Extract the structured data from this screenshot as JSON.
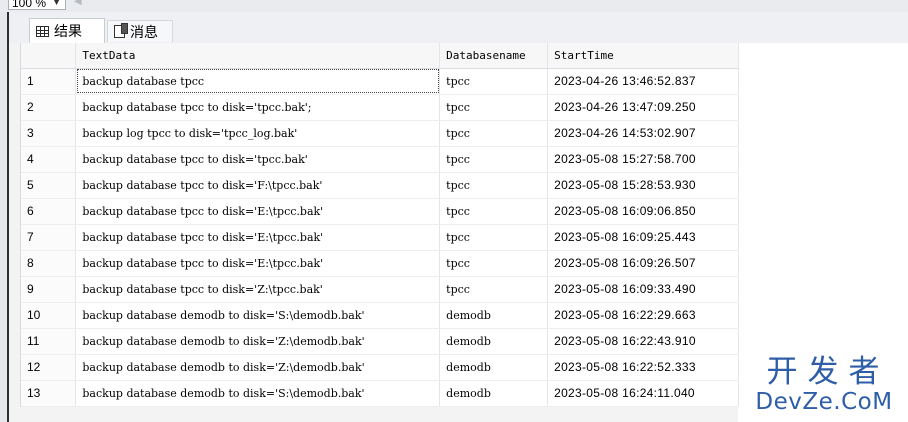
{
  "zoom": {
    "value": "100 %"
  },
  "tabs": [
    {
      "label": "结果",
      "icon": "grid-icon",
      "active": true
    },
    {
      "label": "消息",
      "icon": "message-icon",
      "active": false
    }
  ],
  "grid": {
    "columns": [
      "TextData",
      "Databasename",
      "StartTime"
    ],
    "rows": [
      {
        "num": "1",
        "text": "backup database tpcc",
        "db": "tpcc",
        "time": "2023-04-26 13:46:52.837"
      },
      {
        "num": "2",
        "text": "backup database tpcc to disk='tpcc.bak';",
        "db": "tpcc",
        "time": "2023-04-26 13:47:09.250"
      },
      {
        "num": "3",
        "text": "backup log tpcc to disk='tpcc_log.bak'",
        "db": "tpcc",
        "time": "2023-04-26 14:53:02.907"
      },
      {
        "num": "4",
        "text": "backup database tpcc to disk='tpcc.bak'",
        "db": "tpcc",
        "time": "2023-05-08 15:27:58.700"
      },
      {
        "num": "5",
        "text": "backup database tpcc to disk='F:\\tpcc.bak'",
        "db": "tpcc",
        "time": "2023-05-08 15:28:53.930"
      },
      {
        "num": "6",
        "text": "backup database tpcc to disk='E:\\tpcc.bak'",
        "db": "tpcc",
        "time": "2023-05-08 16:09:06.850"
      },
      {
        "num": "7",
        "text": "backup database tpcc to disk='E:\\tpcc.bak'",
        "db": "tpcc",
        "time": "2023-05-08 16:09:25.443"
      },
      {
        "num": "8",
        "text": "backup database tpcc to disk='E:\\tpcc.bak'",
        "db": "tpcc",
        "time": "2023-05-08 16:09:26.507"
      },
      {
        "num": "9",
        "text": "backup database tpcc to disk='Z:\\tpcc.bak'",
        "db": "tpcc",
        "time": "2023-05-08 16:09:33.490"
      },
      {
        "num": "10",
        "text": "backup database demodb to disk='S:\\demodb.bak'",
        "db": "demodb",
        "time": "2023-05-08 16:22:29.663"
      },
      {
        "num": "11",
        "text": "backup database demodb to disk='Z:\\demodb.bak'",
        "db": "demodb",
        "time": "2023-05-08 16:22:43.910"
      },
      {
        "num": "12",
        "text": "backup database demodb to disk='Z:\\demodb.bak'",
        "db": "demodb",
        "time": "2023-05-08 16:22:52.333"
      },
      {
        "num": "13",
        "text": "backup database demodb to disk='S:\\demodb.bak'",
        "db": "demodb",
        "time": "2023-05-08 16:24:11.040"
      }
    ]
  },
  "watermark": {
    "cn": "开发者",
    "en": "DevZe.CoM"
  },
  "colors": {
    "watermark": "#2f5ea8",
    "grid_bg": "#ffffff",
    "header_bg": "#f7f7f7"
  }
}
